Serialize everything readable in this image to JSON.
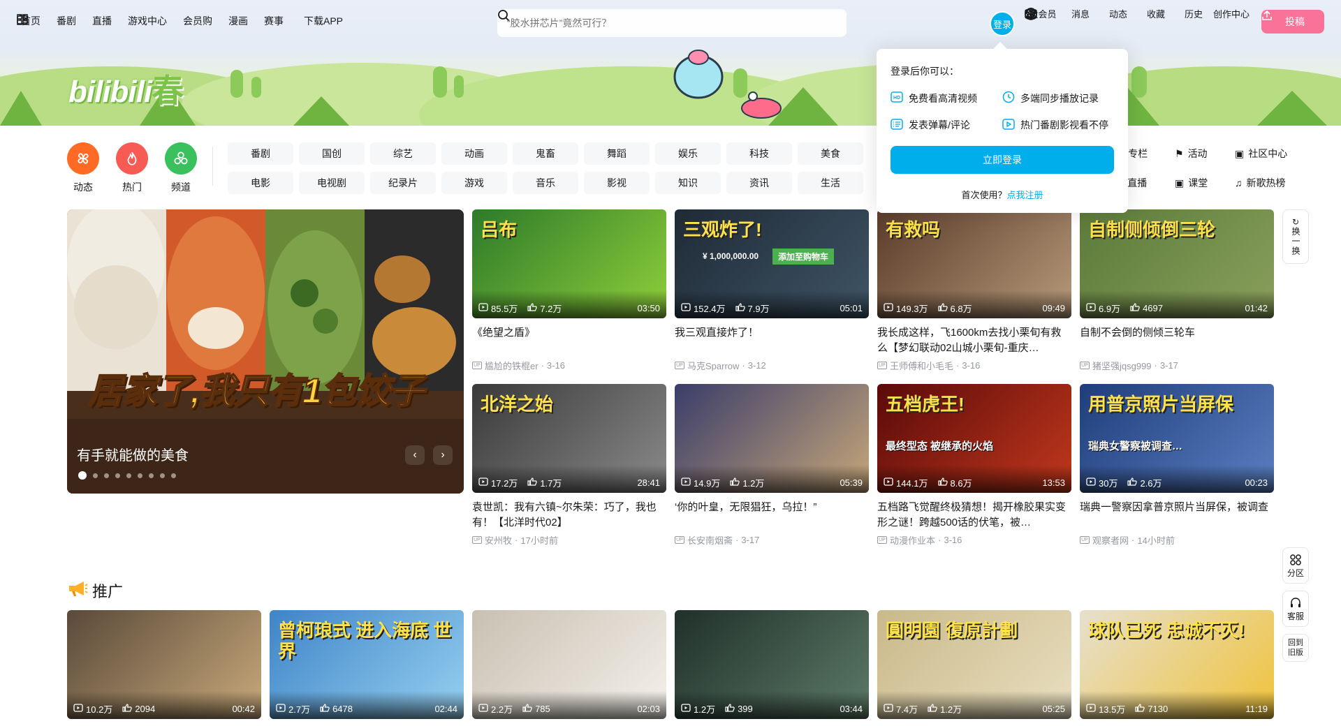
{
  "header": {
    "nav": [
      {
        "label": "首页",
        "icon": "tv-icon"
      },
      {
        "label": "番剧"
      },
      {
        "label": "直播"
      },
      {
        "label": "游戏中心"
      },
      {
        "label": "会员购"
      },
      {
        "label": "漫画"
      },
      {
        "label": "赛事"
      },
      {
        "label": "下载APP",
        "icon": "app-download-icon"
      }
    ],
    "search_placeholder": "“胶水拼芯片”竟然可行？",
    "login_label": "登录",
    "right_nav": [
      {
        "label": "大会员",
        "icon": "vip-icon"
      },
      {
        "label": "消息",
        "icon": "mail-icon"
      },
      {
        "label": "动态",
        "icon": "fan-icon"
      },
      {
        "label": "收藏",
        "icon": "star-icon"
      },
      {
        "label": "历史",
        "icon": "clock-icon"
      },
      {
        "label": "创作中心",
        "icon": "bulb-icon"
      }
    ],
    "upload_label": "投稿",
    "logo_text": "bilibili",
    "logo_season": "春"
  },
  "quick_links": [
    {
      "label": "动态",
      "icon": "fan-icon",
      "color": "#ff6b24"
    },
    {
      "label": "热门",
      "icon": "flame-icon",
      "color": "#f85a54"
    },
    {
      "label": "频道",
      "icon": "channel-icon",
      "color": "#3ac05c"
    }
  ],
  "channels_row1": [
    "番剧",
    "国创",
    "综艺",
    "动画",
    "鬼畜",
    "舞蹈",
    "娱乐",
    "科技",
    "美食"
  ],
  "channels_row2": [
    "电影",
    "电视剧",
    "纪录片",
    "游戏",
    "音乐",
    "影视",
    "知识",
    "资讯",
    "生活"
  ],
  "extra_links": [
    {
      "label": "专栏",
      "icon": "column-icon"
    },
    {
      "label": "活动",
      "icon": "flag-icon"
    },
    {
      "label": "社区中心",
      "icon": "community-icon"
    },
    {
      "label": "直播",
      "icon": "live-icon"
    },
    {
      "label": "课堂",
      "icon": "classroom-icon"
    },
    {
      "label": "新歌热榜",
      "icon": "music-chart-icon"
    }
  ],
  "login_popover": {
    "title": "登录后你可以：",
    "items": [
      {
        "label": "免费看高清视频",
        "icon": "hd-icon"
      },
      {
        "label": "多端同步播放记录",
        "icon": "sync-clock-icon"
      },
      {
        "label": "发表弹幕/评论",
        "icon": "comment-icon"
      },
      {
        "label": "热门番剧影视看不停",
        "icon": "play-box-icon"
      }
    ],
    "button": "立即登录",
    "first_time": "首次使用？",
    "register": "点我注册"
  },
  "carousel": {
    "title": "有手就能做的美食",
    "caption": "居家了,我只有1包饺子",
    "dot_count": 9,
    "active_dot": 0
  },
  "videos": [
    {
      "title": "《绝望之盾》",
      "views": "85.5万",
      "likes": "7.2万",
      "duration": "03:50",
      "author": "尴尬的铁棍er",
      "date": "3-16",
      "thumb_text": "吕布"
    },
    {
      "title": "我三观直接炸了！",
      "views": "152.4万",
      "likes": "7.9万",
      "duration": "05:01",
      "author": "马克Sparrow",
      "date": "3-12",
      "thumb_text": "三观炸了!",
      "thumb_price": "¥ 1,000,000.00",
      "thumb_btn": "添加至购物车"
    },
    {
      "title": "我长成这样，飞1600km去找小栗旬有救么【梦幻联动02山城小栗旬-重庆…",
      "views": "149.3万",
      "likes": "6.8万",
      "duration": "09:49",
      "author": "王师傅和小毛毛",
      "date": "3-16",
      "thumb_text": "有救吗"
    },
    {
      "title": "自制不会倒的侧倾三轮车",
      "views": "6.9万",
      "likes": "4697",
      "duration": "01:42",
      "author": "猪坚强jqsg999",
      "date": "3-17",
      "thumb_text": "自制侧倾倒三轮"
    },
    {
      "title": "袁世凯：我有六镇~尔朱荣：巧了，我也有！【北洋时代02】",
      "views": "17.2万",
      "likes": "1.7万",
      "duration": "28:41",
      "author": "安州牧",
      "date": "17小时前",
      "thumb_text": "北洋之始"
    },
    {
      "title": "‘你的叶皇，无限猖狂，乌拉！”",
      "views": "14.9万",
      "likes": "1.2万",
      "duration": "05:39",
      "author": "长安南烟斋",
      "date": "3-17",
      "thumb_text": ""
    },
    {
      "title": "五档路飞觉醒终极猜想！揭开橡胶果实变形之谜！跨越500话的伏笔，被…",
      "views": "144.1万",
      "likes": "8.6万",
      "duration": "13:53",
      "author": "动漫作业本",
      "date": "3-16",
      "thumb_text": "五档虎王!",
      "thumb_sub": "最终型态 被继承的火焰"
    },
    {
      "title": "瑞典一警察因拿普京照片当屏保，被调查",
      "views": "30万",
      "likes": "2.6万",
      "duration": "00:23",
      "author": "观察者网",
      "date": "14小时前",
      "thumb_text": "用普京照片当屏保",
      "thumb_sub": "瑞典女警察被调查…"
    }
  ],
  "promo": {
    "title": "推广",
    "videos": [
      {
        "views": "10.2万",
        "likes": "2094",
        "duration": "00:42",
        "thumb_text": ""
      },
      {
        "views": "2.7万",
        "likes": "6478",
        "duration": "02:44",
        "thumb_text": "曾柯琅式 进入海底 世界"
      },
      {
        "views": "2.2万",
        "likes": "785",
        "duration": "02:03",
        "thumb_text": ""
      },
      {
        "views": "1.2万",
        "likes": "399",
        "duration": "03:44",
        "thumb_text": ""
      },
      {
        "views": "7.4万",
        "likes": "1.2万",
        "duration": "05:25",
        "thumb_text": "圓明園 復原計劃"
      },
      {
        "views": "13.5万",
        "likes": "7130",
        "duration": "11:19",
        "thumb_text": "球队已死 忠诚不灭!"
      }
    ]
  },
  "side": {
    "refresh": "换一换",
    "category": "分区",
    "service": "客服",
    "old": "回到旧版"
  }
}
